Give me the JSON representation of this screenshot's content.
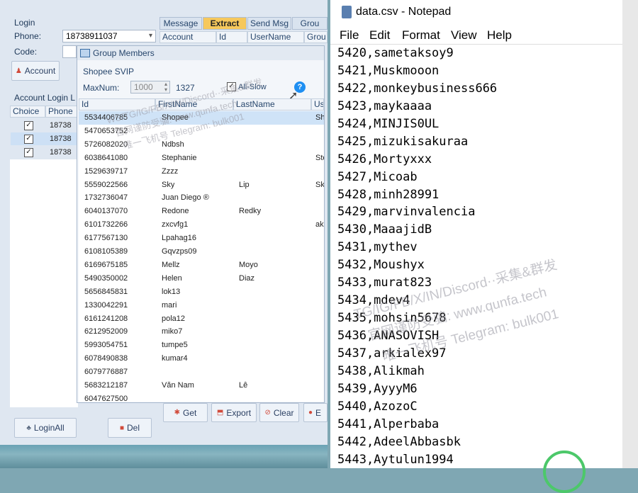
{
  "login": {
    "group_title": "Login",
    "phone_label": "Phone:",
    "phone_value": "18738911037",
    "code_label": "Code:",
    "account_button": "Account",
    "account_login_label": "Account Login L",
    "grid_headers": [
      "Choice",
      "Phone"
    ],
    "rows": [
      "18738",
      "18738",
      "18738"
    ],
    "loginall_button": "LoginAll",
    "del_button": "Del"
  },
  "tabs": [
    "Message",
    "Extract",
    "Send Msg",
    "Grou"
  ],
  "tab_columns": [
    "Account",
    "Id",
    "UserName",
    "Grou"
  ],
  "group_members": {
    "title": "Group Members",
    "group_name": "Shopee SVIP",
    "maxnum_label": "MaxNum:",
    "maxnum_value": "1000",
    "count": "1327",
    "allslow_label": "All-Slow",
    "help": "?",
    "headers": [
      "Id",
      "FirstName",
      "LastName",
      "Us"
    ],
    "rows": [
      {
        "id": "5534406785",
        "first": "Shopee",
        "last": "",
        "us": "Sh"
      },
      {
        "id": "5470653752",
        "first": "",
        "last": "",
        "us": ""
      },
      {
        "id": "5726082020",
        "first": "Ndbsh",
        "last": "",
        "us": ""
      },
      {
        "id": "6038641080",
        "first": "Stephanie",
        "last": "",
        "us": "Ste"
      },
      {
        "id": "1529639717",
        "first": "Zzzz",
        "last": "",
        "us": ""
      },
      {
        "id": "5559022566",
        "first": "Sky",
        "last": "Lip",
        "us": "Sk"
      },
      {
        "id": "1732736047",
        "first": "Juan Diego ®",
        "last": "",
        "us": ""
      },
      {
        "id": "6040137070",
        "first": "Redone",
        "last": "Redky",
        "us": ""
      },
      {
        "id": "6101732266",
        "first": "zxcvfg1",
        "last": "",
        "us": "ak"
      },
      {
        "id": "6177567130",
        "first": "Lpahag16",
        "last": "",
        "us": ""
      },
      {
        "id": "6108105389",
        "first": "Gqvzps09",
        "last": "",
        "us": ""
      },
      {
        "id": "6169675185",
        "first": "Mellz",
        "last": "Moyo",
        "us": ""
      },
      {
        "id": "5490350002",
        "first": "Helen",
        "last": "Diaz",
        "us": ""
      },
      {
        "id": "5656845831",
        "first": "lok13",
        "last": "",
        "us": ""
      },
      {
        "id": "1330042291",
        "first": "mari",
        "last": "",
        "us": ""
      },
      {
        "id": "6161241208",
        "first": "pola12",
        "last": "",
        "us": ""
      },
      {
        "id": "6212952009",
        "first": "miko7",
        "last": "",
        "us": ""
      },
      {
        "id": "5993054751",
        "first": "tumpe5",
        "last": "",
        "us": ""
      },
      {
        "id": "6078490838",
        "first": "kumar4",
        "last": "",
        "us": ""
      },
      {
        "id": "6079776887",
        "first": "",
        "last": "",
        "us": ""
      },
      {
        "id": "5683212187",
        "first": "Văn Nam",
        "last": "Lê",
        "us": ""
      },
      {
        "id": "6047627500",
        "first": "",
        "last": "",
        "us": ""
      }
    ]
  },
  "bottom_buttons": {
    "get": "Get",
    "export": "Export",
    "clear": "Clear",
    "e": "E"
  },
  "notepad": {
    "title": "data.csv - Notepad",
    "menu": [
      "File",
      "Edit",
      "Format",
      "View",
      "Help"
    ],
    "lines": [
      "5420,sametaksoy9",
      "5421,Muskmooon",
      "5422,monkeybusiness666",
      "5423,maykaaaa",
      "5424,MINJIS0UL",
      "5425,mizukisakuraa",
      "5426,Mortyxxx",
      "5427,Micoab",
      "5428,minh28991",
      "5429,marvinvalencia",
      "5430,MaaajidB",
      "5431,mythev",
      "5432,Moushyx",
      "5433,murat823",
      "5434,mdev4",
      "5435,mohsin5678",
      "5436,ANASOVISH",
      "5437,arkialex97",
      "5438,Alikmah",
      "5439,AyyyM6",
      "5440,AzozoC",
      "5441,Alperbaba",
      "5442,AdeelAbbasbk",
      "5443,Aytulun1994"
    ]
  },
  "watermarks": {
    "w1": "WS/TG/IG/FB/X/IN/Discord··采集&群发",
    "w2": "官网谨防受骗: www.qunfa.tech",
    "w3": "唯一飞机号 Telegram: bulk001",
    "w4": "TG/IG/FB/X/IN/Discord··采集&群发",
    "w5": "官网谨防受骗: www.qunfa.tech",
    "w6": "唯一飞机号 Telegram: bulk001"
  },
  "colors": {
    "active_tab": "#f6c85c",
    "selected_row": "#cfe3f7",
    "accent": "#27466c"
  }
}
